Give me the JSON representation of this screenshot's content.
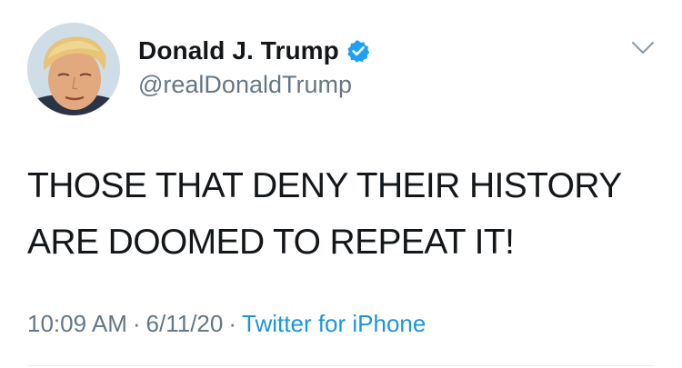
{
  "user": {
    "display_name": "Donald J. Trump",
    "handle": "@realDonaldTrump",
    "verified_icon": "verified-badge-icon",
    "avatar_icon": "profile-avatar"
  },
  "tweet": {
    "text_lines": [
      "THOSE THAT DENY THEIR HISTORY",
      "ARE DOOMED TO REPEAT IT!"
    ]
  },
  "meta": {
    "time": "10:09 AM",
    "separator": "·",
    "date": "6/11/20",
    "source": "Twitter for iPhone"
  },
  "menu": {
    "icon": "chevron-down-icon"
  },
  "colors": {
    "text": "#14171a",
    "secondary": "#657786",
    "accent": "#1b95e0",
    "verified": "#1da1f2"
  }
}
